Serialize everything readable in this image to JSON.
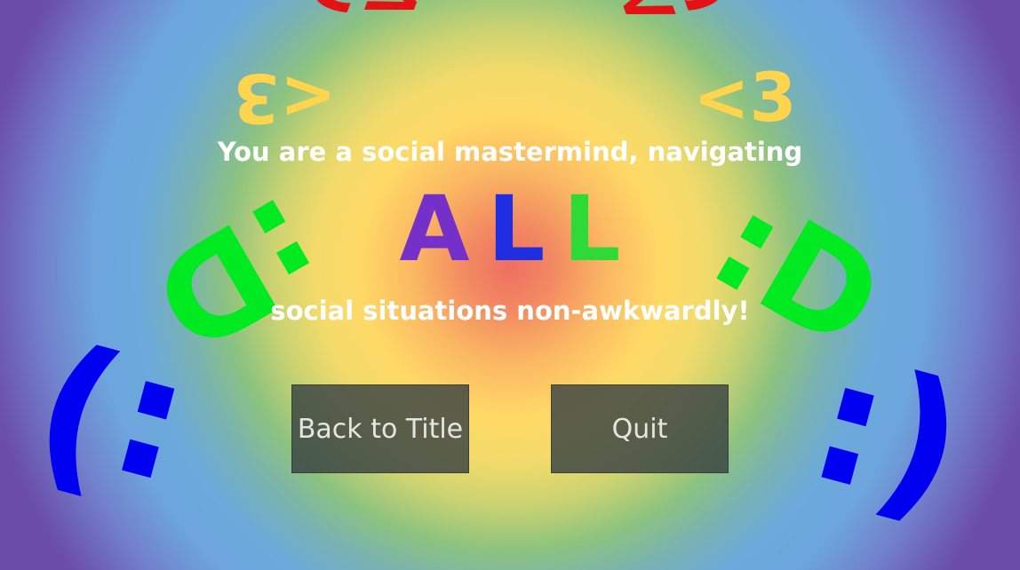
{
  "decorations": {
    "heart": "<3",
    "grin": ":D",
    "smile": ":)"
  },
  "message": {
    "line1": "You are a social mastermind, navigating",
    "highlight": [
      "A",
      "L",
      "L"
    ],
    "line2": "social situations non-awkwardly!"
  },
  "highlight_colors": [
    "#7430c9",
    "#1e2ee0",
    "#2edb36"
  ],
  "decoration_colors": {
    "heart_outer": "#e31214",
    "heart_inner": "#ffd44e",
    "grin": "#00ea22",
    "smile": "#0000f0"
  },
  "buttons": {
    "back_label": "Back to Title",
    "quit_label": "Quit"
  }
}
